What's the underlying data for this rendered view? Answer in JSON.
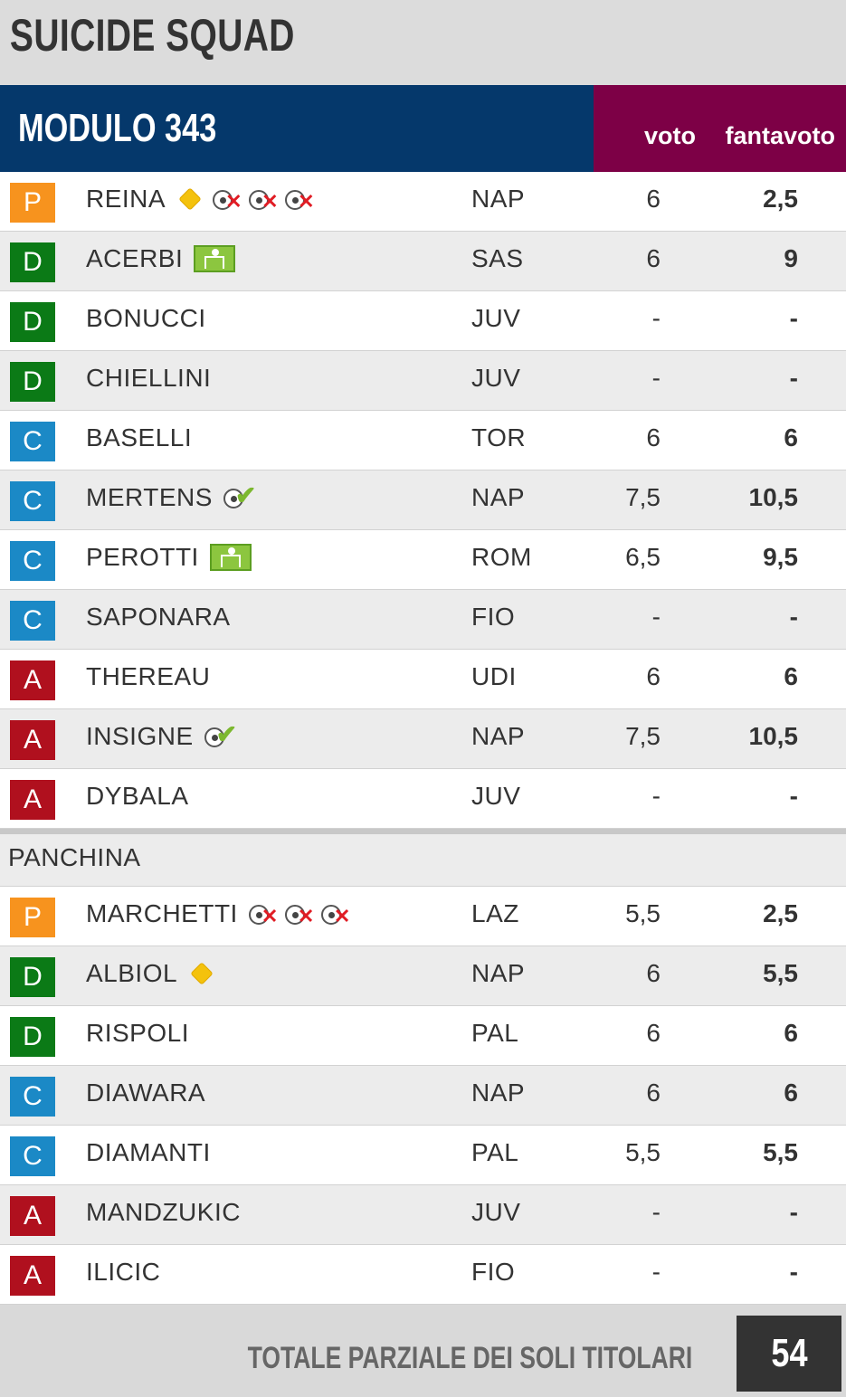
{
  "title": "SUICIDE SQUAD",
  "module": "MODULO 343",
  "col_voto": "voto",
  "col_fantavoto": "fantavoto",
  "starters": [
    {
      "role": "P",
      "name": "REINA",
      "team": "NAP",
      "voto": "6",
      "fantavoto": "2,5",
      "icons": [
        "yellow-card-icon",
        "goal-conceded-icon",
        "goal-conceded-icon",
        "goal-conceded-icon"
      ]
    },
    {
      "role": "D",
      "name": "ACERBI",
      "team": "SAS",
      "voto": "6",
      "fantavoto": "9",
      "icons": [
        "assist-pitch-icon"
      ]
    },
    {
      "role": "D",
      "name": "BONUCCI",
      "team": "JUV",
      "voto": "-",
      "fantavoto": "-",
      "icons": []
    },
    {
      "role": "D",
      "name": "CHIELLINI",
      "team": "JUV",
      "voto": "-",
      "fantavoto": "-",
      "icons": []
    },
    {
      "role": "C",
      "name": "BASELLI",
      "team": "TOR",
      "voto": "6",
      "fantavoto": "6",
      "icons": []
    },
    {
      "role": "C",
      "name": "MERTENS",
      "team": "NAP",
      "voto": "7,5",
      "fantavoto": "10,5",
      "icons": [
        "goal-scored-icon"
      ]
    },
    {
      "role": "C",
      "name": "PEROTTI",
      "team": "ROM",
      "voto": "6,5",
      "fantavoto": "9,5",
      "icons": [
        "assist-pitch-icon"
      ]
    },
    {
      "role": "C",
      "name": "SAPONARA",
      "team": "FIO",
      "voto": "-",
      "fantavoto": "-",
      "icons": []
    },
    {
      "role": "A",
      "name": "THEREAU",
      "team": "UDI",
      "voto": "6",
      "fantavoto": "6",
      "icons": []
    },
    {
      "role": "A",
      "name": "INSIGNE",
      "team": "NAP",
      "voto": "7,5",
      "fantavoto": "10,5",
      "icons": [
        "goal-scored-icon"
      ]
    },
    {
      "role": "A",
      "name": "DYBALA",
      "team": "JUV",
      "voto": "-",
      "fantavoto": "-",
      "icons": []
    }
  ],
  "bench_label": "PANCHINA",
  "bench": [
    {
      "role": "P",
      "name": "MARCHETTI",
      "team": "LAZ",
      "voto": "5,5",
      "fantavoto": "2,5",
      "icons": [
        "goal-conceded-icon",
        "goal-conceded-icon",
        "goal-conceded-icon"
      ]
    },
    {
      "role": "D",
      "name": "ALBIOL",
      "team": "NAP",
      "voto": "6",
      "fantavoto": "5,5",
      "icons": [
        "yellow-card-icon"
      ]
    },
    {
      "role": "D",
      "name": "RISPOLI",
      "team": "PAL",
      "voto": "6",
      "fantavoto": "6",
      "icons": []
    },
    {
      "role": "C",
      "name": "DIAWARA",
      "team": "NAP",
      "voto": "6",
      "fantavoto": "6",
      "icons": []
    },
    {
      "role": "C",
      "name": "DIAMANTI",
      "team": "PAL",
      "voto": "5,5",
      "fantavoto": "5,5",
      "icons": []
    },
    {
      "role": "A",
      "name": "MANDZUKIC",
      "team": "JUV",
      "voto": "-",
      "fantavoto": "-",
      "icons": []
    },
    {
      "role": "A",
      "name": "ILICIC",
      "team": "FIO",
      "voto": "-",
      "fantavoto": "-",
      "icons": []
    }
  ],
  "total_label": "TOTALE PARZIALE DEI SOLI TITOLARI",
  "total_value": "54"
}
